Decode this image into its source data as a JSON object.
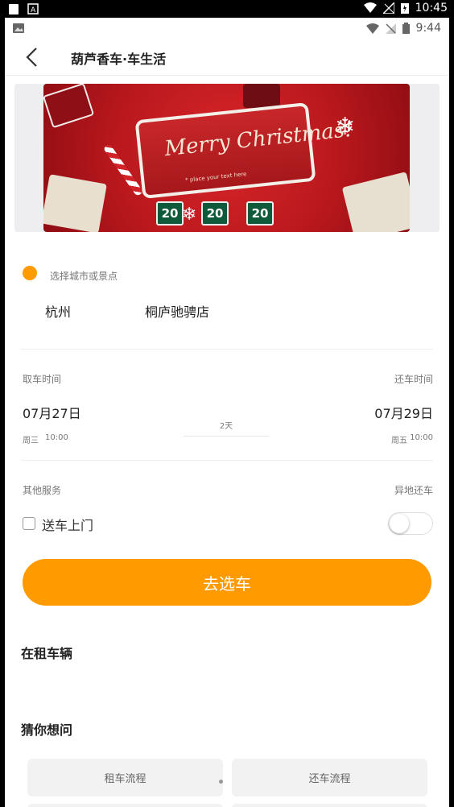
{
  "outer_status": {
    "time": "10:45"
  },
  "inner_status": {
    "time": "9:44"
  },
  "nav": {
    "title": "葫芦香车·车生活"
  },
  "banner": {
    "headline": "Merry Christmas!",
    "subline": "* place your text here",
    "tags": [
      "20",
      "20",
      "20"
    ]
  },
  "location": {
    "hint": "选择城市或景点",
    "city": "杭州",
    "store": "桐庐驰骋店"
  },
  "pickup": {
    "label": "取车时间",
    "date": "07月27日",
    "weekday": "周三",
    "time": "10:00"
  },
  "dropoff": {
    "label": "还车时间",
    "date": "07月29日",
    "weekday": "周五",
    "time": "10:00"
  },
  "duration": "2天",
  "services": {
    "label": "其他服务",
    "other_label": "异地还车",
    "deliver_label": "送车上门",
    "deliver_checked": false,
    "return_elsewhere_on": false
  },
  "go_button": "去选车",
  "renting_title": "在租车辆",
  "faq_title": "猜你想问",
  "faq_items": [
    "租车流程",
    "还车流程"
  ],
  "colors": {
    "accent": "#ff9a00"
  }
}
